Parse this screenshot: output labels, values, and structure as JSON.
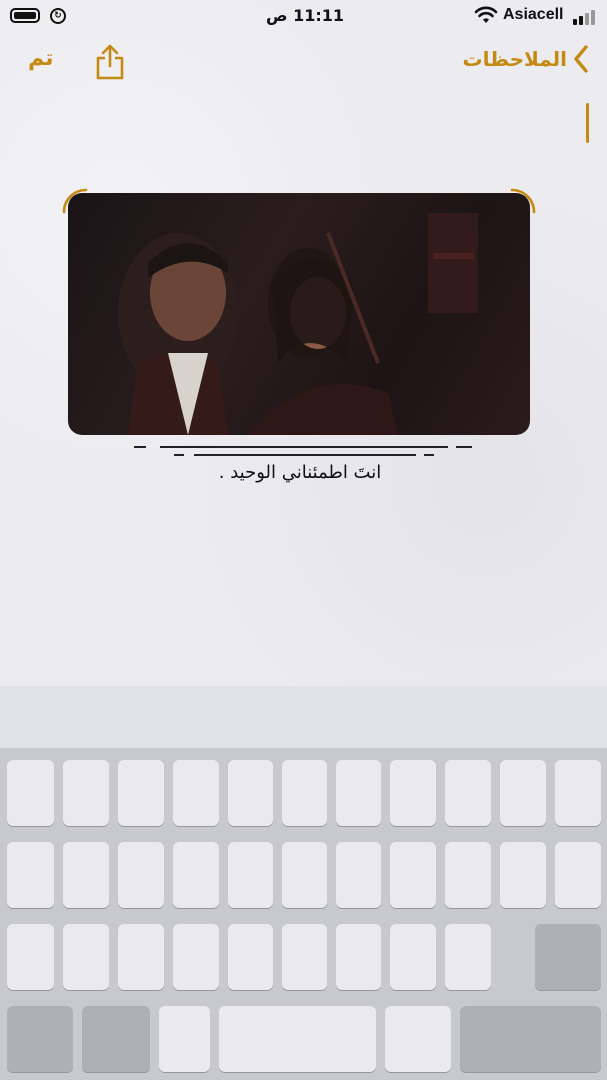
{
  "status_bar": {
    "time": "11:11 ص",
    "carrier": "Asiacell",
    "battery_level": 1.0
  },
  "nav": {
    "done_label": "تم",
    "back_label": "الملاحظات",
    "icons": [
      "share-icon",
      "chevron-left-icon"
    ]
  },
  "note": {
    "caption": "انتَ اطمئناني الوحيد ."
  },
  "colors": {
    "accent": "#c48a14",
    "paper": "#ececf0",
    "keyboard": "#c8c9cf",
    "key": "#e9e9ee"
  }
}
